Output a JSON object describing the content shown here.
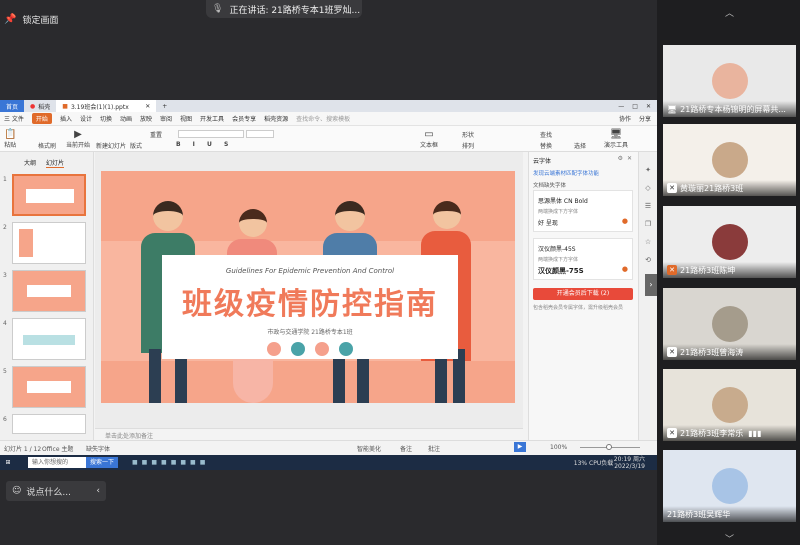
{
  "meeting": {
    "lock_label": "锁定画面",
    "speaking_label": "正在讲话: 21路桥专本1班罗灿...",
    "chat_placeholder": "说点什么...",
    "participants": [
      {
        "name": "21路桥专本杨锦明的屏幕共...",
        "muted": false
      },
      {
        "name": "黄璇丽21路桥3班",
        "muted": true
      },
      {
        "name": "21路桥3班陈坤",
        "muted": true
      },
      {
        "name": "21路桥3班曾海涛",
        "muted": true
      },
      {
        "name": "21路桥3班李常乐",
        "muted": true
      },
      {
        "name": "21路桥3班吴辉华",
        "muted": false
      }
    ]
  },
  "ppt": {
    "tabs": [
      "首页",
      "稻壳",
      "3.19班会(1)(1).pptx"
    ],
    "menu": [
      "三 文件",
      "开始",
      "插入",
      "设计",
      "切换",
      "动画",
      "放映",
      "审阅",
      "视图",
      "开发工具",
      "会员专享",
      "稻壳资源"
    ],
    "active_menu": "开始",
    "search_placeholder": "查找命令、搜索模板",
    "share_labels": [
      "协作",
      "分享"
    ],
    "ribbon": [
      "粘贴",
      "格式刷",
      "当前开始",
      "新建幻灯片",
      "版式",
      "重置",
      "文本框",
      "形状",
      "排列",
      "查找",
      "替换",
      "选择",
      "演示工具"
    ],
    "pane_tabs": [
      "大纲",
      "幻灯片"
    ],
    "slide_numbers": [
      "1",
      "2",
      "3",
      "4",
      "5",
      "6"
    ],
    "slide": {
      "subtitle_en": "Guidelines For Epidemic Prevention And Control",
      "title": "班级疫情防控指南",
      "school": "市政与交通学院   21路桥专本1班"
    },
    "font_panel": {
      "title": "云字体",
      "link": "发现云端素材匹配字体功能",
      "section": "文档缺失字体",
      "font1_name": "思源黑体 CN Bold",
      "font1_desc": "两端换成下方字体",
      "font1_sample": "好 呈现",
      "font2_name": "汉仪颜黑-45S",
      "font2_desc": "两端换成下方字体",
      "font2_sample": "汉仪颜黑-75S",
      "download_button": "开通会员后下载 (2)",
      "note": "包含稻壳会员专属字体，需升级稻壳会员"
    },
    "notes_placeholder": "单击此处添加备注",
    "status": {
      "slide_count": "幻灯片 1 / 12",
      "theme": "Office 主题",
      "missing_font": "缺失字体",
      "smart_beautify": "智能美化",
      "notes": "备注",
      "comments": "批注",
      "zoom": "100%"
    }
  },
  "taskbar": {
    "search_placeholder": "输入你想搜的",
    "search_button": "搜索一下",
    "cpu": "13% CPU负载",
    "time": "20:19 周六",
    "date": "2022/3/19"
  },
  "colors": {
    "accent": "#e06a2a",
    "slide_bg": "#f6a58a",
    "title_red": "#f07a5a"
  }
}
